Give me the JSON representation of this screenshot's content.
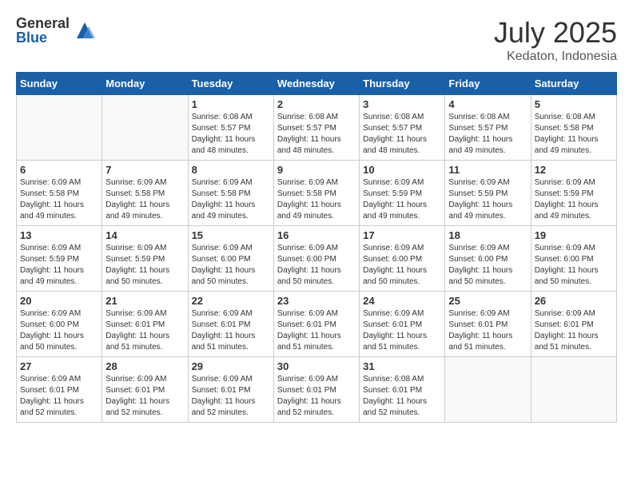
{
  "logo": {
    "general": "General",
    "blue": "Blue"
  },
  "title": {
    "month": "July 2025",
    "location": "Kedaton, Indonesia"
  },
  "weekdays": [
    "Sunday",
    "Monday",
    "Tuesday",
    "Wednesday",
    "Thursday",
    "Friday",
    "Saturday"
  ],
  "weeks": [
    [
      {
        "day": "",
        "info": ""
      },
      {
        "day": "",
        "info": ""
      },
      {
        "day": "1",
        "info": "Sunrise: 6:08 AM\nSunset: 5:57 PM\nDaylight: 11 hours and 48 minutes."
      },
      {
        "day": "2",
        "info": "Sunrise: 6:08 AM\nSunset: 5:57 PM\nDaylight: 11 hours and 48 minutes."
      },
      {
        "day": "3",
        "info": "Sunrise: 6:08 AM\nSunset: 5:57 PM\nDaylight: 11 hours and 48 minutes."
      },
      {
        "day": "4",
        "info": "Sunrise: 6:08 AM\nSunset: 5:57 PM\nDaylight: 11 hours and 49 minutes."
      },
      {
        "day": "5",
        "info": "Sunrise: 6:08 AM\nSunset: 5:58 PM\nDaylight: 11 hours and 49 minutes."
      }
    ],
    [
      {
        "day": "6",
        "info": "Sunrise: 6:09 AM\nSunset: 5:58 PM\nDaylight: 11 hours and 49 minutes."
      },
      {
        "day": "7",
        "info": "Sunrise: 6:09 AM\nSunset: 5:58 PM\nDaylight: 11 hours and 49 minutes."
      },
      {
        "day": "8",
        "info": "Sunrise: 6:09 AM\nSunset: 5:58 PM\nDaylight: 11 hours and 49 minutes."
      },
      {
        "day": "9",
        "info": "Sunrise: 6:09 AM\nSunset: 5:58 PM\nDaylight: 11 hours and 49 minutes."
      },
      {
        "day": "10",
        "info": "Sunrise: 6:09 AM\nSunset: 5:59 PM\nDaylight: 11 hours and 49 minutes."
      },
      {
        "day": "11",
        "info": "Sunrise: 6:09 AM\nSunset: 5:59 PM\nDaylight: 11 hours and 49 minutes."
      },
      {
        "day": "12",
        "info": "Sunrise: 6:09 AM\nSunset: 5:59 PM\nDaylight: 11 hours and 49 minutes."
      }
    ],
    [
      {
        "day": "13",
        "info": "Sunrise: 6:09 AM\nSunset: 5:59 PM\nDaylight: 11 hours and 49 minutes."
      },
      {
        "day": "14",
        "info": "Sunrise: 6:09 AM\nSunset: 5:59 PM\nDaylight: 11 hours and 50 minutes."
      },
      {
        "day": "15",
        "info": "Sunrise: 6:09 AM\nSunset: 6:00 PM\nDaylight: 11 hours and 50 minutes."
      },
      {
        "day": "16",
        "info": "Sunrise: 6:09 AM\nSunset: 6:00 PM\nDaylight: 11 hours and 50 minutes."
      },
      {
        "day": "17",
        "info": "Sunrise: 6:09 AM\nSunset: 6:00 PM\nDaylight: 11 hours and 50 minutes."
      },
      {
        "day": "18",
        "info": "Sunrise: 6:09 AM\nSunset: 6:00 PM\nDaylight: 11 hours and 50 minutes."
      },
      {
        "day": "19",
        "info": "Sunrise: 6:09 AM\nSunset: 6:00 PM\nDaylight: 11 hours and 50 minutes."
      }
    ],
    [
      {
        "day": "20",
        "info": "Sunrise: 6:09 AM\nSunset: 6:00 PM\nDaylight: 11 hours and 50 minutes."
      },
      {
        "day": "21",
        "info": "Sunrise: 6:09 AM\nSunset: 6:01 PM\nDaylight: 11 hours and 51 minutes."
      },
      {
        "day": "22",
        "info": "Sunrise: 6:09 AM\nSunset: 6:01 PM\nDaylight: 11 hours and 51 minutes."
      },
      {
        "day": "23",
        "info": "Sunrise: 6:09 AM\nSunset: 6:01 PM\nDaylight: 11 hours and 51 minutes."
      },
      {
        "day": "24",
        "info": "Sunrise: 6:09 AM\nSunset: 6:01 PM\nDaylight: 11 hours and 51 minutes."
      },
      {
        "day": "25",
        "info": "Sunrise: 6:09 AM\nSunset: 6:01 PM\nDaylight: 11 hours and 51 minutes."
      },
      {
        "day": "26",
        "info": "Sunrise: 6:09 AM\nSunset: 6:01 PM\nDaylight: 11 hours and 51 minutes."
      }
    ],
    [
      {
        "day": "27",
        "info": "Sunrise: 6:09 AM\nSunset: 6:01 PM\nDaylight: 11 hours and 52 minutes."
      },
      {
        "day": "28",
        "info": "Sunrise: 6:09 AM\nSunset: 6:01 PM\nDaylight: 11 hours and 52 minutes."
      },
      {
        "day": "29",
        "info": "Sunrise: 6:09 AM\nSunset: 6:01 PM\nDaylight: 11 hours and 52 minutes."
      },
      {
        "day": "30",
        "info": "Sunrise: 6:09 AM\nSunset: 6:01 PM\nDaylight: 11 hours and 52 minutes."
      },
      {
        "day": "31",
        "info": "Sunrise: 6:08 AM\nSunset: 6:01 PM\nDaylight: 11 hours and 52 minutes."
      },
      {
        "day": "",
        "info": ""
      },
      {
        "day": "",
        "info": ""
      }
    ]
  ]
}
